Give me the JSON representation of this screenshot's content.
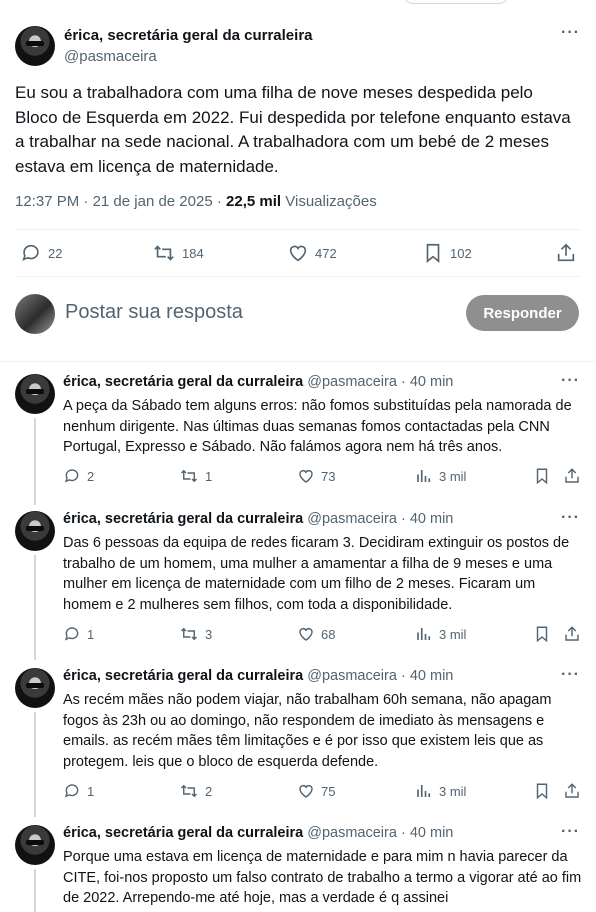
{
  "tweet": {
    "author_name": "érica, secretária geral da curraleira",
    "author_handle": "@pasmaceira",
    "more_label": "···",
    "text": "Eu sou a trabalhadora com uma filha de nove meses despedida pelo Bloco de Esquerda em 2022. Fui despedida por telefone enquanto estava a trabalhar na sede nacional. A trabalhadora com um bebé de 2 meses estava em licença de maternidade.",
    "time": "12:37 PM",
    "date": "21 de jan de 2025",
    "dot": "·",
    "views_count": "22,5 mil",
    "views_label": "Visualizações",
    "replies": "22",
    "retweets": "184",
    "likes": "472",
    "bookmarks": "102"
  },
  "composer": {
    "placeholder": "Postar sua resposta",
    "button_label": "Responder"
  },
  "replies": [
    {
      "name": "érica, secretária geral da curraleira",
      "handle": "@pasmaceira",
      "dot": "·",
      "time": "40 min",
      "text": "A peça da Sábado tem alguns erros: não fomos substituídas pela namorada de nenhum dirigente. Nas últimas duas semanas fomos contactadas pela CNN Portugal, Expresso e Sábado. Não falámos agora nem há três anos.",
      "replies": "2",
      "retweets": "1",
      "likes": "73",
      "views": "3 mil"
    },
    {
      "name": "érica, secretária geral da curraleira",
      "handle": "@pasmaceira",
      "dot": "·",
      "time": "40 min",
      "text": "Das 6 pessoas da equipa de redes ficaram 3. Decidiram extinguir os postos de trabalho de um homem, uma mulher a amamentar a filha de 9 meses e uma mulher em licença de maternidade com um filho de 2 meses. Ficaram um homem e 2 mulheres sem filhos, com toda a disponibilidade.",
      "replies": "1",
      "retweets": "3",
      "likes": "68",
      "views": "3 mil"
    },
    {
      "name": "érica, secretária geral da curraleira",
      "handle": "@pasmaceira",
      "dot": "·",
      "time": "40 min",
      "text": "As recém mães não podem viajar, não trabalham 60h semana, não apagam fogos às 23h ou ao domingo, não respondem de imediato às mensagens e emails. as recém mães têm limitações e é por isso que existem leis que as protegem. leis que o bloco de esquerda defende.",
      "replies": "1",
      "retweets": "2",
      "likes": "75",
      "views": "3 mil"
    },
    {
      "name": "érica, secretária geral da curraleira",
      "handle": "@pasmaceira",
      "dot": "·",
      "time": "40 min",
      "text": "Porque uma estava em licença de maternidade e para mim n havia parecer da CITE, foi-nos proposto um falso contrato de trabalho a termo a vigorar até ao fim de 2022. Arrependo-me até hoje, mas a verdade é q assinei"
    }
  ],
  "icons": {
    "reply": "reply-icon",
    "retweet": "retweet-icon",
    "like": "like-icon",
    "bookmark": "bookmark-icon",
    "share": "share-icon",
    "views": "views-icon"
  },
  "colors": {
    "text": "#0f1419",
    "muted": "#536471",
    "separator": "#eff3f4",
    "button_disabled": "#8f8f8f"
  }
}
